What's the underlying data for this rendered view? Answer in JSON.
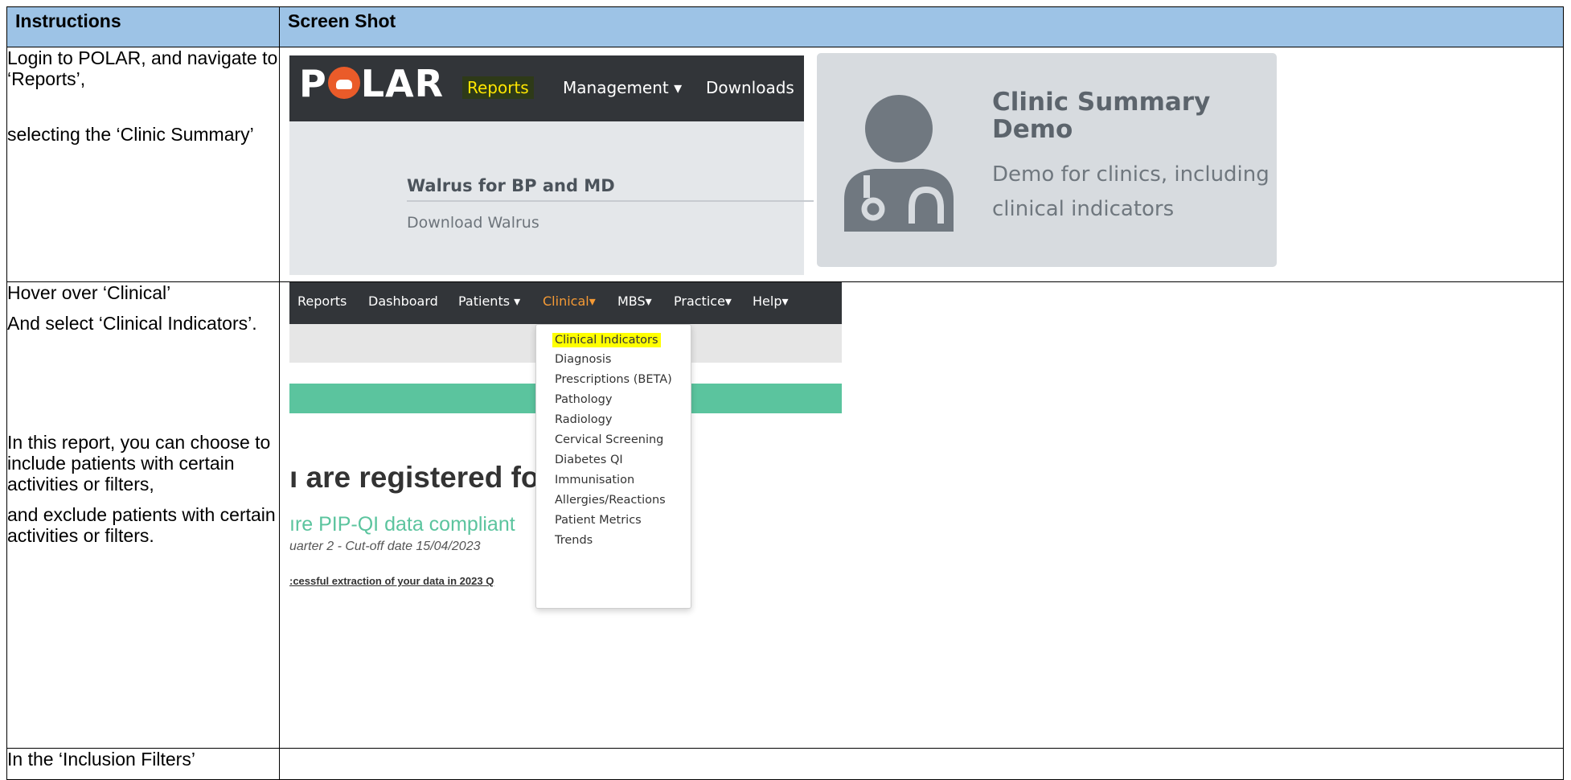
{
  "table": {
    "header_instructions": "Instructions",
    "header_screenshot": "Screen Shot"
  },
  "row1": {
    "instr_a": "Login to POLAR, and navigate to ‘Reports’,",
    "instr_b": "selecting the ‘Clinic Summary’",
    "polar": {
      "logo": "POLAR",
      "nav_reports": "Reports",
      "nav_management": "Management ▾",
      "nav_downloads": "Downloads",
      "walrus_title": "Walrus for BP and MD",
      "walrus_link": "Download Walrus"
    },
    "card": {
      "title": "Clinic Summary Demo",
      "description": "Demo for clinics, including clinical indicators",
      "icon": "doctor-icon"
    }
  },
  "row2": {
    "instr_a": "Hover over ‘Clinical’",
    "instr_b": "And select ‘Clinical Indicators’.",
    "instr_c": "In this report, you can choose to include patients with certain activities or filters,",
    "instr_d": "and exclude patients with certain activities or filters.",
    "nav": {
      "reports": "Reports",
      "dashboard": "Dashboard",
      "patients": "Patients ▾",
      "clinical": "Clinical▾",
      "mbs": "MBS▾",
      "practice": "Practice▾",
      "help": "Help▾"
    },
    "page": {
      "big_text": "ı are registered for",
      "green_text": "ıre PIP-QI data compliant",
      "quarter_text": "uarter 2 - Cut-off date 15/04/2023",
      "extract_text": ":cessful extraction of your data in 2023 Q"
    },
    "dropdown": [
      "Clinical Indicators",
      "Diagnosis",
      "Prescriptions (BETA)",
      "Pathology",
      "Radiology",
      "Cervical Screening",
      "Diabetes QI",
      "Immunisation",
      "Allergies/Reactions",
      "Patient Metrics",
      "Trends"
    ],
    "highlight_color": "#ffff00",
    "active_color": "#f59a35"
  },
  "row3": {
    "instr_a": "In the ‘Inclusion Filters’"
  }
}
